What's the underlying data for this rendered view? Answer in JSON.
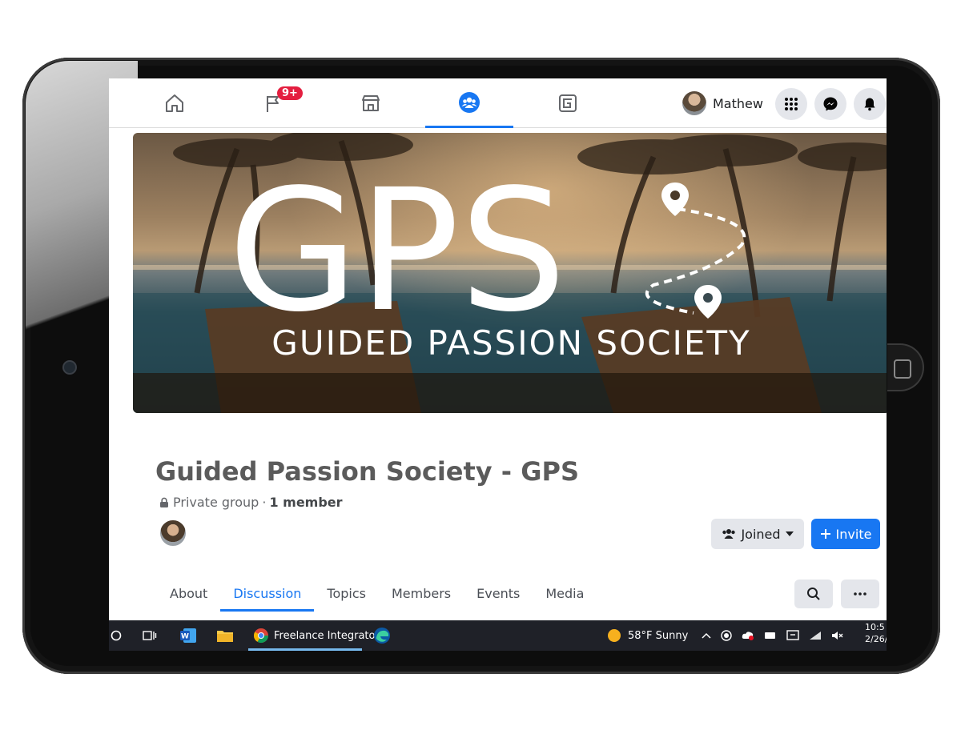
{
  "topnav": {
    "notifications_badge": "9+",
    "profile_name": "Mathew",
    "icons": [
      "home-icon",
      "flag-icon",
      "marketplace-icon",
      "groups-icon",
      "gaming-icon",
      "menu-grid-icon",
      "messenger-icon",
      "bell-icon"
    ]
  },
  "cover": {
    "logo_text": "GPS",
    "subtitle": "GUIDED PASSION SOCIETY"
  },
  "group": {
    "name": "Guided Passion Society - GPS",
    "privacy": "Private group",
    "separator": "·",
    "member_count": "1 member"
  },
  "actions": {
    "joined_label": "Joined",
    "invite_label": "Invite"
  },
  "tabs": [
    "About",
    "Discussion",
    "Topics",
    "Members",
    "Events",
    "Media"
  ],
  "active_tab": "Discussion",
  "taskbar": {
    "chrome_tab_label": "Freelance Integrato...",
    "weather": "58°F  Sunny",
    "time": "10:5",
    "date": "2/26/"
  },
  "colors": {
    "accent": "#1877f2",
    "badge": "#e41e3f",
    "taskbar": "#1f2128"
  }
}
